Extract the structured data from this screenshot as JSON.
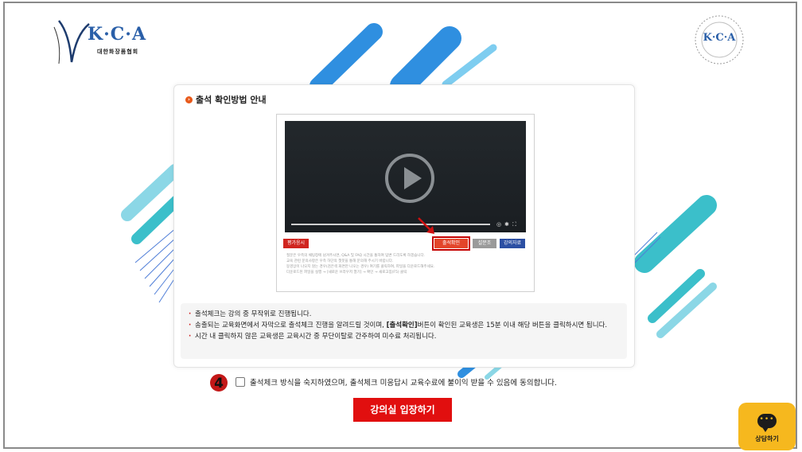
{
  "header": {
    "logo_left_text": "K·C·A",
    "logo_left_subtitle": "대한화장품협회",
    "logo_right_text": "K·C·A"
  },
  "card": {
    "title": "출석 확인방법 안내",
    "screenshot": {
      "buttons": {
        "left": "평가응시",
        "attendance": "출석확인",
        "survey": "설문조사",
        "material": "강의자료"
      },
      "fine_print": [
        "질문은 우측의 채팅창에 남겨주시면, Q&A 및 FAQ 시간을 통하여 답변 드리도록 하겠습니다.",
        "교육 관련 문의사항은 우측 하단의 챗봇을 통해 문의해 주시기 바랍니다.",
        "동영상이 나오지 않는 경우(검은색 화면만 나오는 경우) 여기를 클릭하여, 파일을 다운로드해주세요.",
        "다운로드된 파일을 실행 → [새로운 브라우저 열기] → 확인 → 새로고침(F5) 클릭"
      ]
    },
    "notes": [
      {
        "text": "출석체크는 강의 중 무작위로 진행됩니다."
      },
      {
        "pre": "송출되는 교육화면에서 자막으로 출석체크 진행을 알려드릴 것이며, ",
        "bold": "[출석확인]",
        "post": "버튼이 확인된 교육생은 15분 이내 해당 버튼을 클릭하시면 됩니다."
      },
      {
        "text": "시간 내 클릭하지 않은 교육생은 교육시간 중 무단이탈로 간주하여 미수료 처리됩니다."
      }
    ]
  },
  "step_badge": "4",
  "agreement_text": "출석체크 방식을 숙지하였으며, 출석체크 미응답시 교육수료에 불이익 받을 수 있음에 동의합니다.",
  "enter_button": "강의실 입장하기",
  "chat_button": "상담하기",
  "icons": {
    "play": "play-icon",
    "arrow": "red-arrow-icon",
    "chat": "chat-bubble-icon"
  },
  "colors": {
    "primary_red": "#e10f0f",
    "accent_blue": "#2f8fe0",
    "accent_teal": "#3bbfca",
    "chat_yellow": "#f6b81e"
  }
}
